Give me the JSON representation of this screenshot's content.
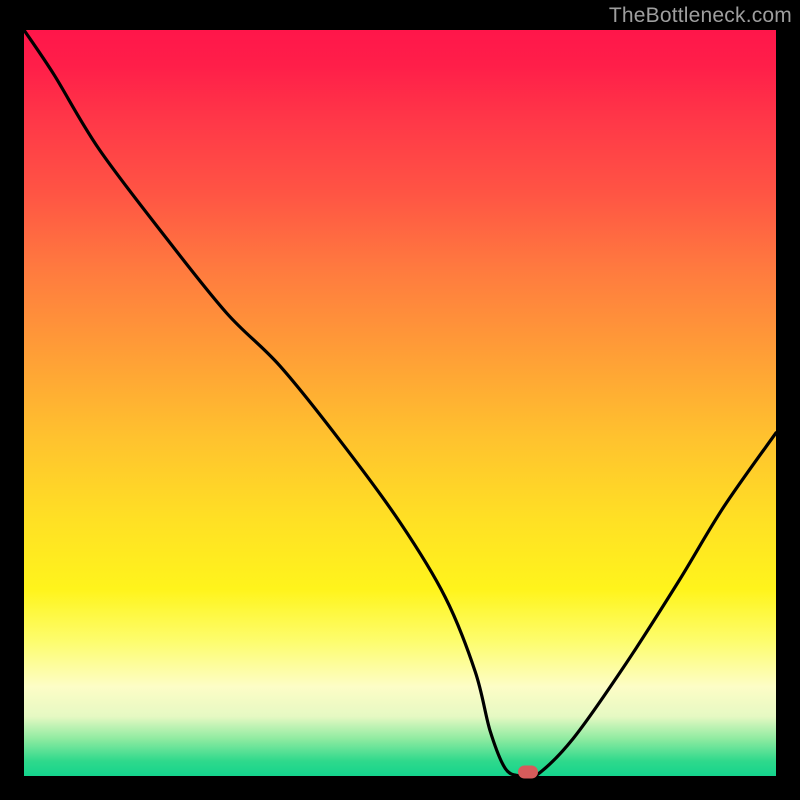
{
  "watermark": {
    "text": "TheBottleneck.com"
  },
  "colors": {
    "background": "#000000",
    "marker": "#d65b5b",
    "curve": "#000000"
  },
  "chart_data": {
    "type": "line",
    "title": "",
    "xlabel": "",
    "ylabel": "",
    "xlim": [
      0,
      100
    ],
    "ylim": [
      0,
      100
    ],
    "legend": false,
    "grid": false,
    "series": [
      {
        "name": "bottleneck-curve",
        "x": [
          0,
          4,
          10,
          19,
          27,
          34,
          42,
          50,
          56,
          60,
          62,
          64,
          66,
          68,
          73,
          80,
          87,
          93,
          100
        ],
        "values": [
          100,
          94,
          84,
          72,
          62,
          55,
          45,
          34,
          24,
          14,
          6,
          1,
          0,
          0,
          5,
          15,
          26,
          36,
          46
        ]
      }
    ],
    "markers": [
      {
        "name": "user-config-marker",
        "x": 67,
        "y": 0
      }
    ],
    "background_gradient_note": "vertical red→orange→yellow→green gradient indicating bottleneck severity by vertical position"
  }
}
